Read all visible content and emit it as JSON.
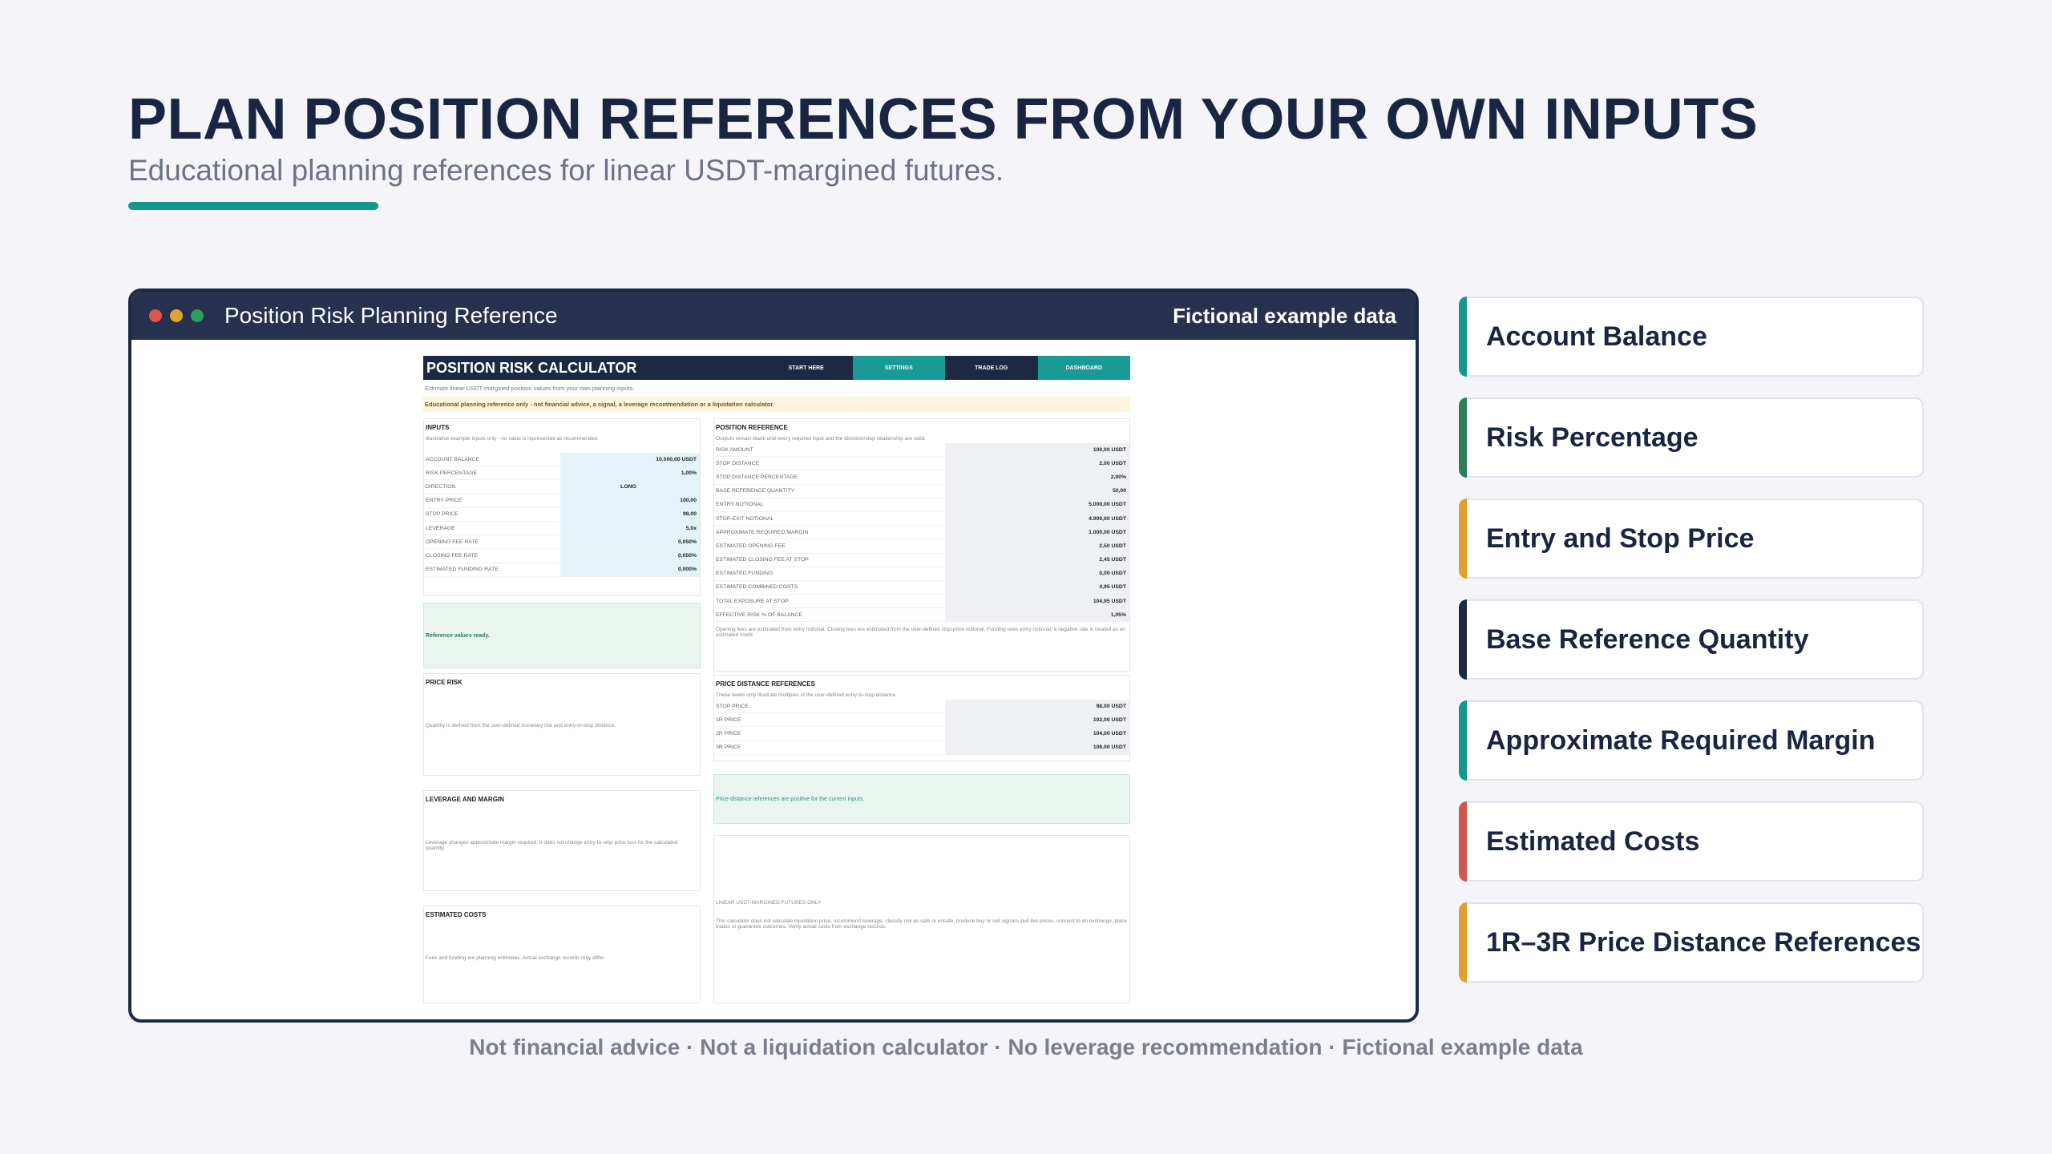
{
  "headline": "PLAN POSITION REFERENCES FROM YOUR OWN INPUTS",
  "subtitle": "Educational planning references for linear USDT-margined futures.",
  "window": {
    "title": "Position Risk Planning Reference",
    "badge": "Fictional example data"
  },
  "sheet": {
    "title": "POSITION RISK CALCULATOR",
    "tabs": [
      "START HERE",
      "SETTINGS",
      "TRADE LOG",
      "DASHBOARD"
    ],
    "description": "Estimate linear USDT-margined position values from your own planning inputs.",
    "warning": "Educational planning reference only - not financial advice, a signal, a leverage recommendation or a liquidation calculator.",
    "inputs": {
      "title": "INPUTS",
      "note": "Illustrative example inputs only - no value is represented as recommended.",
      "rows": [
        {
          "label": "ACCOUNT BALANCE",
          "value": "10.000,00 USDT"
        },
        {
          "label": "RISK PERCENTAGE",
          "value": "1,00%"
        },
        {
          "label": "DIRECTION",
          "value": "LONG"
        },
        {
          "label": "ENTRY PRICE",
          "value": "100,00"
        },
        {
          "label": "STOP PRICE",
          "value": "98,00"
        },
        {
          "label": "LEVERAGE",
          "value": "5,0x"
        },
        {
          "label": "OPENING FEE RATE",
          "value": "0,050%"
        },
        {
          "label": "CLOSING FEE RATE",
          "value": "0,050%"
        },
        {
          "label": "ESTIMATED FUNDING RATE",
          "value": "0,000%"
        }
      ],
      "status": "Reference values ready."
    },
    "price_risk": {
      "title": "PRICE RISK",
      "note": "Quantity is derived from the user-defined monetary risk and entry-to-stop distance."
    },
    "leverage_margin": {
      "title": "LEVERAGE AND MARGIN",
      "note": "Leverage changes approximate margin required. It does not change entry-to-stop price loss for the calculated quantity."
    },
    "estimated_costs": {
      "title": "ESTIMATED COSTS",
      "note": "Fees and funding are planning estimates. Actual exchange records may differ."
    },
    "position_reference": {
      "title": "POSITION REFERENCE",
      "note": "Outputs remain blank until every required input and the direction/stop relationship are valid.",
      "rows": [
        {
          "label": "RISK AMOUNT",
          "value": "100,00 USDT"
        },
        {
          "label": "STOP DISTANCE",
          "value": "2,00 USDT"
        },
        {
          "label": "STOP DISTANCE PERCENTAGE",
          "value": "2,00%"
        },
        {
          "label": "BASE REFERENCE QUANTITY",
          "value": "50,00"
        },
        {
          "label": "ENTRY NOTIONAL",
          "value": "5.000,00 USDT"
        },
        {
          "label": "STOP-EXIT NOTIONAL",
          "value": "4.900,00 USDT"
        },
        {
          "label": "APPROXIMATE REQUIRED MARGIN",
          "value": "1.000,00 USDT"
        },
        {
          "label": "ESTIMATED OPENING FEE",
          "value": "2,50 USDT"
        },
        {
          "label": "ESTIMATED CLOSING FEE AT STOP",
          "value": "2,45 USDT"
        },
        {
          "label": "ESTIMATED FUNDING",
          "value": "0,00 USDT"
        },
        {
          "label": "ESTIMATED COMBINED COSTS",
          "value": "4,95 USDT"
        },
        {
          "label": "TOTAL EXPOSURE AT STOP",
          "value": "104,95 USDT"
        },
        {
          "label": "EFFECTIVE RISK % OF BALANCE",
          "value": "1,05%"
        }
      ],
      "footnote": "Opening fees are estimated from entry notional. Closing fees are estimated from the user-defined stop-price notional. Funding uses entry notional; a negative rate is treated as an estimated credit."
    },
    "price_distance": {
      "title": "PRICE DISTANCE REFERENCES",
      "note": "These levels only illustrate multiples of the user-defined entry-to-stop distance.",
      "rows": [
        {
          "label": "STOP PRICE",
          "value": "98,00 USDT"
        },
        {
          "label": "1R PRICE",
          "value": "102,00 USDT"
        },
        {
          "label": "2R PRICE",
          "value": "104,00 USDT"
        },
        {
          "label": "3R PRICE",
          "value": "106,00 USDT"
        }
      ],
      "status": "Price-distance references are positive for the current inputs."
    },
    "disclaimer": {
      "title": "LINEAR USDT-MARGINED FUTURES ONLY",
      "text": "This calculator does not calculate liquidation price, recommend leverage, classify risk as safe or unsafe, produce buy or sell signals, pull live prices, connect to an exchange, place trades or guarantee outcomes. Verify actual costs from exchange records."
    }
  },
  "cards": [
    {
      "label": "Account Balance",
      "color": "#15978f"
    },
    {
      "label": "Risk Percentage",
      "color": "#2e7d5a"
    },
    {
      "label": "Entry and Stop Price",
      "color": "#e0a030"
    },
    {
      "label": "Base Reference Quantity",
      "color": "#1d2943"
    },
    {
      "label": "Approximate Required Margin",
      "color": "#15978f"
    },
    {
      "label": "Estimated Costs",
      "color": "#cf574f"
    },
    {
      "label": "1R–3R Price Distance References",
      "color": "#e0a030"
    }
  ],
  "footer": "Not financial advice · Not a liquidation calculator · No leverage recommendation · Fictional example data"
}
